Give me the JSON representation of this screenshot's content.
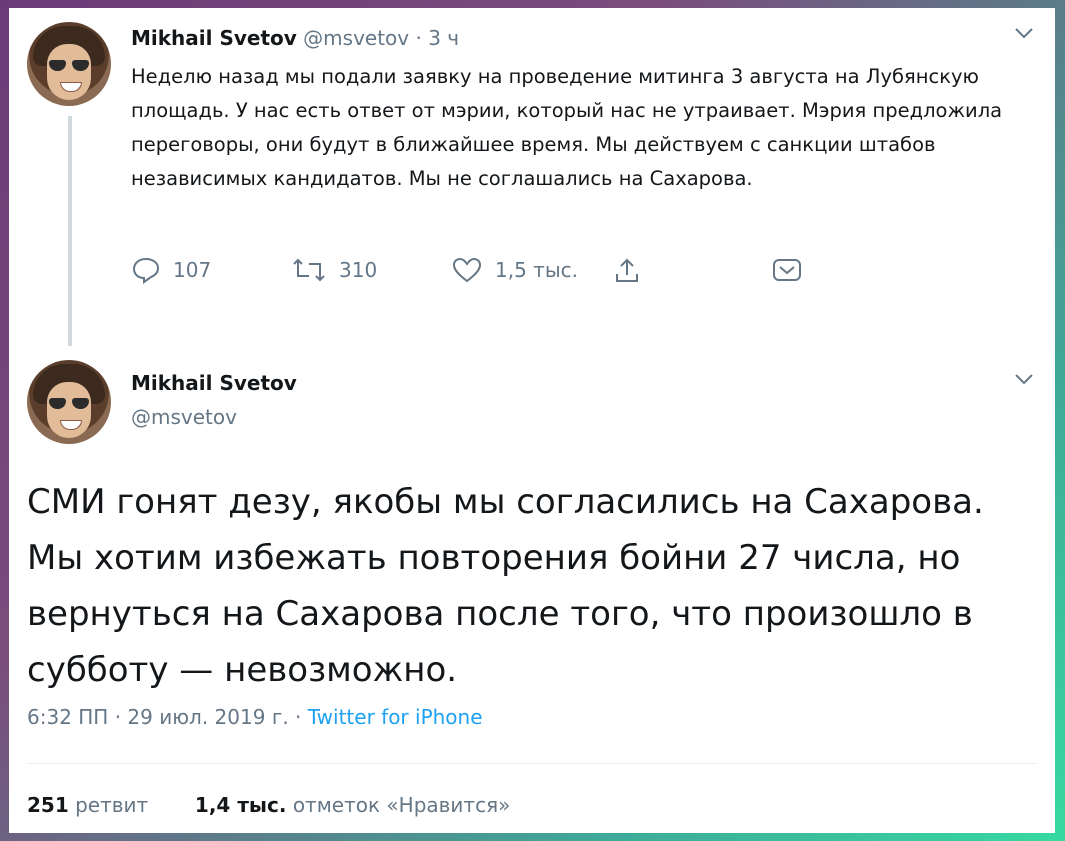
{
  "tweet1": {
    "name": "Mikhail Svetov",
    "handle": "@msvetov",
    "dot": "·",
    "time": "3 ч",
    "text": "Неделю назад мы подали заявку на проведение митинга 3 августа на Лубянскую площадь. У нас есть ответ от мэрии, который нас не утраивает. Мэрия предложила переговоры, они будут в ближайшее время. Мы действуем с санкции штабов независимых кандидатов. Мы не соглашались на Сахарова.",
    "replies": "107",
    "retweets": "310",
    "likes": "1,5 тыс."
  },
  "tweet2": {
    "name": "Mikhail Svetov",
    "handle": "@msvetov",
    "text": "СМИ гонят дезу, якобы мы согласились на Сахарова. Мы хотим избежать повторения бойни 27 числа, но вернуться на Сахарова после того, что произошло в субботу — невозможно.",
    "timestamp": "6:32 ПП · 29 июл. 2019 г. · ",
    "source": "Twitter for iPhone",
    "retweet_count": "251",
    "retweet_label": "ретвит",
    "like_count": "1,4 тыс.",
    "like_label": "отметок «Нравится»"
  },
  "icons": {
    "reply": "reply-icon",
    "retweet": "retweet-icon",
    "like": "heart-icon",
    "share": "share-icon",
    "dm": "direct-message-icon",
    "caret": "chevron-down-icon"
  },
  "colors": {
    "link": "#1da1f2",
    "muted": "#657786",
    "text": "#14171a"
  }
}
